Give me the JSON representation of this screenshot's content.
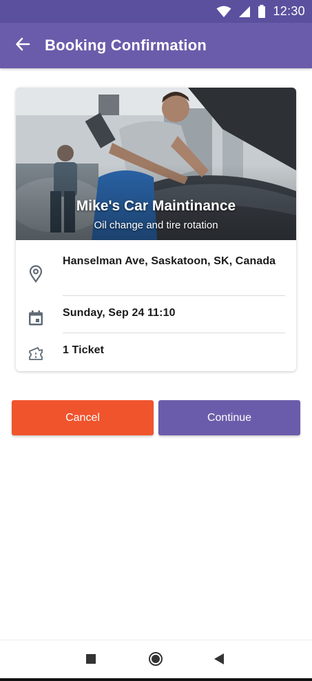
{
  "status_bar": {
    "time": "12:30",
    "icons": [
      "wifi-icon",
      "signal-icon",
      "battery-icon"
    ]
  },
  "app_bar": {
    "title": "Booking Confirmation",
    "back_icon": "arrow-back-icon"
  },
  "card": {
    "hero": {
      "title": "Mike's Car Maintinance",
      "subtitle": "Oil change and tire rotation"
    },
    "details": [
      {
        "icon": "location-pin-icon",
        "text": "Hanselman Ave, Saskatoon, SK, Canada"
      },
      {
        "icon": "calendar-icon",
        "text": "Sunday, Sep 24 11:10"
      },
      {
        "icon": "ticket-icon",
        "text": "1 Ticket"
      }
    ]
  },
  "actions": {
    "cancel_label": "Cancel",
    "continue_label": "Continue"
  },
  "nav_bar": {
    "icons": [
      "recents-square-icon",
      "home-circle-icon",
      "back-triangle-icon"
    ]
  },
  "colors": {
    "status_bar": "#5b509e",
    "app_bar": "#6b5cab",
    "cancel": "#f0542d",
    "continue": "#6b5cab",
    "icon_gray": "#5f6b76"
  }
}
